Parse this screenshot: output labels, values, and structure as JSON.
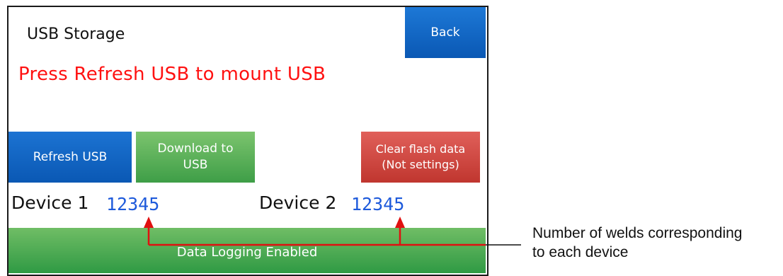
{
  "screen": {
    "title": "USB Storage",
    "back_label": "Back",
    "status_message": "Press Refresh USB to mount USB",
    "buttons": {
      "refresh_label": "Refresh USB",
      "download_line1": "Download to",
      "download_line2": "USB",
      "clear_line1": "Clear flash data",
      "clear_line2": "(Not settings)"
    },
    "devices": [
      {
        "label": "Device 1",
        "count": "12345"
      },
      {
        "label": "Device 2",
        "count": "12345"
      }
    ],
    "status_bar": "Data Logging Enabled"
  },
  "annotation": {
    "line1": "Number of welds corresponding",
    "line2": "to each device"
  },
  "colors": {
    "accent_blue": "#0a58b4",
    "green": "#3e9e47",
    "red_button": "#c0362f",
    "status_text_red": "#ff1111",
    "count_blue": "#1e5adb",
    "callout_red": "#e01010"
  }
}
